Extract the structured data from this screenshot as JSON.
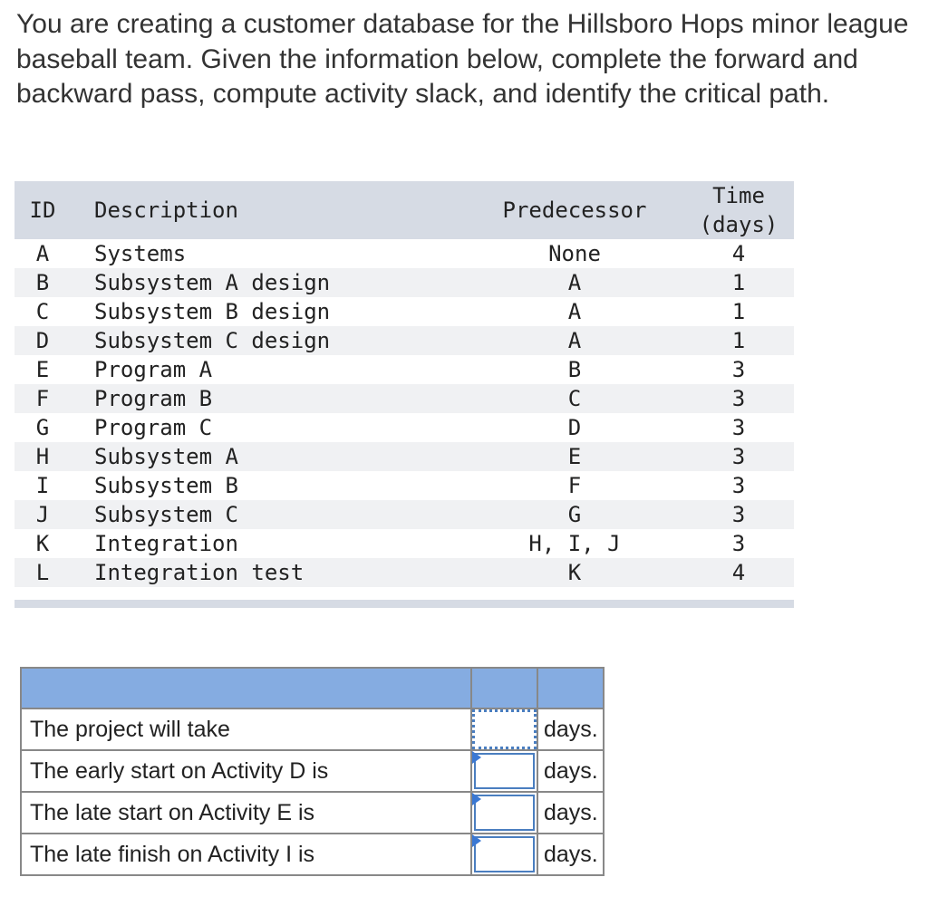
{
  "prompt": "You are creating a customer database for the Hillsboro Hops minor league baseball team. Given the information below, complete the forward and backward pass, compute activity slack, and identify the critical path.",
  "table": {
    "headers": {
      "id": "ID",
      "description": "Description",
      "predecessor": "Predecessor",
      "time_line1": "Time",
      "time_line2": "(days)"
    },
    "rows": [
      {
        "id": "A",
        "description": "Systems",
        "predecessor": "None",
        "time": "4"
      },
      {
        "id": "B",
        "description": "Subsystem A design",
        "predecessor": "A",
        "time": "1"
      },
      {
        "id": "C",
        "description": "Subsystem B design",
        "predecessor": "A",
        "time": "1"
      },
      {
        "id": "D",
        "description": "Subsystem C design",
        "predecessor": "A",
        "time": "1"
      },
      {
        "id": "E",
        "description": "Program A",
        "predecessor": "B",
        "time": "3"
      },
      {
        "id": "F",
        "description": "Program B",
        "predecessor": "C",
        "time": "3"
      },
      {
        "id": "G",
        "description": "Program C",
        "predecessor": "D",
        "time": "3"
      },
      {
        "id": "H",
        "description": "Subsystem A",
        "predecessor": "E",
        "time": "3"
      },
      {
        "id": "I",
        "description": "Subsystem B",
        "predecessor": "F",
        "time": "3"
      },
      {
        "id": "J",
        "description": "Subsystem C",
        "predecessor": "G",
        "time": "3"
      },
      {
        "id": "K",
        "description": "Integration",
        "predecessor": "H, I, J",
        "time": "3"
      },
      {
        "id": "L",
        "description": "Integration test",
        "predecessor": "K",
        "time": "4"
      }
    ]
  },
  "answers": {
    "rows": [
      {
        "question": "The project will take",
        "value": "",
        "unit": "days."
      },
      {
        "question": "The early start on Activity D is",
        "value": "",
        "unit": "days."
      },
      {
        "question": "The late start on Activity E is",
        "value": "",
        "unit": "days."
      },
      {
        "question": "The late finish on Activity I is",
        "value": "",
        "unit": "days."
      }
    ]
  },
  "colors": {
    "header_bg": "#d6dbe4",
    "stripe_bg": "#f0f1f3",
    "answer_header_bg": "#85ace1",
    "input_border": "#4a7ec0"
  }
}
